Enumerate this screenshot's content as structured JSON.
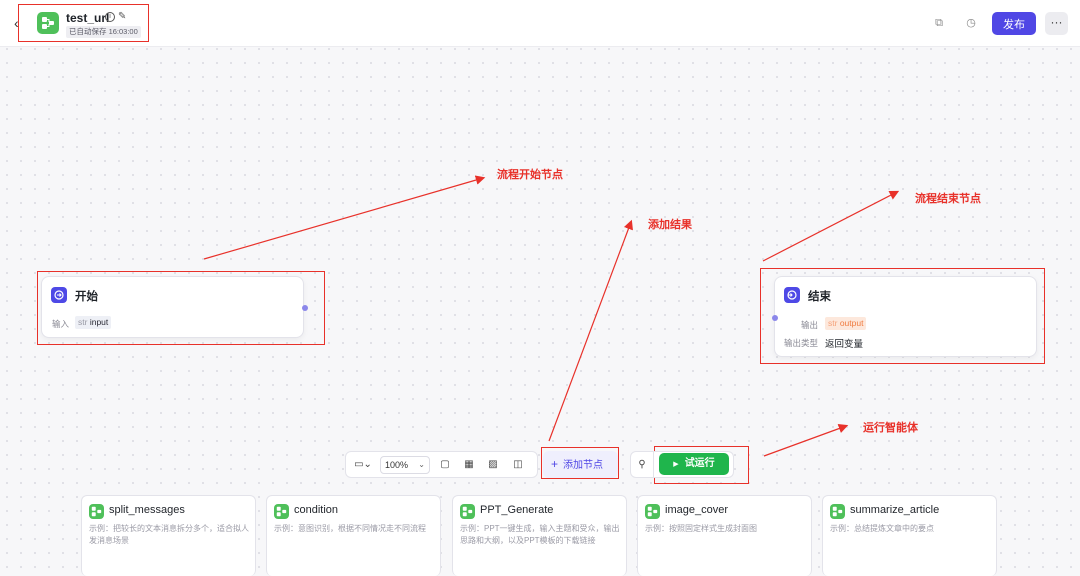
{
  "header": {
    "title": "test_url",
    "autosave": "已自动保存 16:03:00",
    "publish_label": "发布",
    "more_label": "···"
  },
  "colors": {
    "accent": "#5047e5",
    "run_green": "#1fb54c",
    "annotation_red": "#e8312a",
    "tool_green": "#4fc05a"
  },
  "start_node": {
    "title": "开始",
    "input_label": "输入",
    "input_type": "str",
    "input_name": "input"
  },
  "end_node": {
    "title": "结束",
    "output_label": "输出",
    "output_type": "str",
    "output_name": "output",
    "output_kind_label": "输出类型",
    "output_kind_value": "返回变量"
  },
  "annotations": {
    "start": "流程开始节点",
    "add_result": "添加结果",
    "end": "流程结束节点",
    "run": "运行智能体"
  },
  "toolbar": {
    "zoom": "100%",
    "add_node_label": "添加节点",
    "run_label": "试运行"
  },
  "tools": [
    {
      "name": "split_messages",
      "desc": "示例：把较长的文本消息拆分多个，适合拟人发消息场景"
    },
    {
      "name": "condition",
      "desc": "示例：意图识别，根据不同情况走不同流程"
    },
    {
      "name": "PPT_Generate",
      "desc": "示例：PPT一键生成，输入主题和受众，输出思路和大纲，以及PPT模板的下载链接"
    },
    {
      "name": "image_cover",
      "desc": "示例：按照固定样式生成封面图"
    },
    {
      "name": "summarize_article",
      "desc": "示例：总结提炼文章中的要点"
    }
  ]
}
